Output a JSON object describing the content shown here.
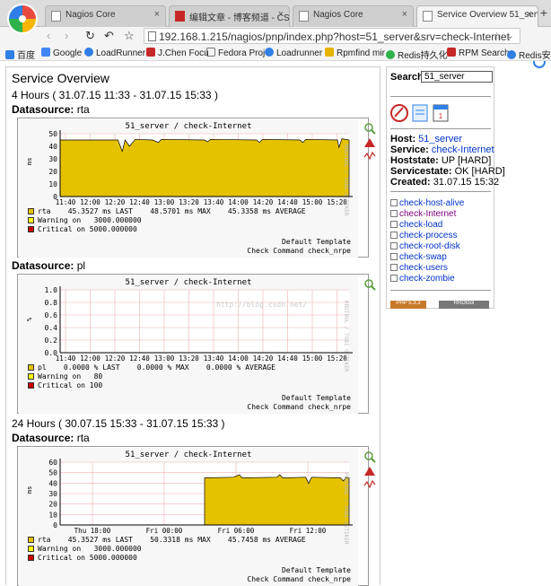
{
  "browser": {
    "tabs": [
      {
        "title": "Nagios Core"
      },
      {
        "title": "编辑文章 - 博客频道 - CSDN"
      },
      {
        "title": "Nagios Core"
      },
      {
        "title": "Service Overview 51_server"
      }
    ],
    "url": "192.168.1.215/nagios/pnp/index.php?host=51_server&srv=check-Internet",
    "bookmarks": [
      "百度",
      "Google",
      "LoadRunner",
      "J.Chen Focu",
      "Fedora Proj",
      "Loadrunner",
      "Rpmfind mir",
      "Redis持久化",
      "RPM Search",
      "Redis安装"
    ]
  },
  "page": {
    "title": "Service Overview",
    "period_4h": "4 Hours ( 31.07.15 11:33 - 31.07.15 15:33 )",
    "period_24h": "24 Hours ( 30.07.15 15:33 - 31.07.15 15:33 )",
    "ds_label": "Datasource:",
    "ds_rta": "rta",
    "ds_pl": "pl"
  },
  "graphs": [
    {
      "title": "51_server / check-Internet",
      "ylabel": "ms",
      "yticks": [
        "50",
        "40",
        "30",
        "20",
        "10",
        "0"
      ],
      "xticks": [
        "11:40",
        "12:00",
        "12:20",
        "12:40",
        "13:00",
        "13:20",
        "13:40",
        "14:00",
        "14:20",
        "14:40",
        "15:00",
        "15:20"
      ],
      "legend": [
        {
          "text": "rta    45.3527 ms LAST    48.5701 ms MAX    45.3358 ms AVERAGE",
          "color": "#e5c200"
        },
        {
          "text": "Warning on   3000.000000",
          "color": "#ffff00"
        },
        {
          "text": "Critical on 5000.000000",
          "color": "#cc0000"
        }
      ],
      "footer": [
        "Default Template",
        "Check Command check_nrpe"
      ]
    },
    {
      "title": "51_server / check-Internet",
      "ylabel": "%",
      "yticks": [
        "1.0",
        "0.8",
        "0.6",
        "0.4",
        "0.2",
        "0.0"
      ],
      "xticks": [
        "11:40",
        "12:00",
        "12:20",
        "12:40",
        "13:00",
        "13:20",
        "13:40",
        "14:00",
        "14:20",
        "14:40",
        "15:00",
        "15:20"
      ],
      "legend": [
        {
          "text": "pl    0.0000 % LAST    0.0000 % MAX    0.0000 % AVERAGE",
          "color": "#e5c200"
        },
        {
          "text": "Warning on   80",
          "color": "#ffff00"
        },
        {
          "text": "Critical on 100",
          "color": "#cc0000"
        }
      ],
      "footer": [
        "Default Template",
        "Check Command check_nrpe"
      ],
      "watermark": "http://blog.csdn.net/"
    },
    {
      "title": "51_server / check-Internet",
      "ylabel": "ms",
      "yticks": [
        "60",
        "50",
        "40",
        "30",
        "20",
        "10",
        "0"
      ],
      "xticks": [
        "Thu 18:00",
        "Fri 00:00",
        "Fri 06:00",
        "Fri 12:00"
      ],
      "legend": [
        {
          "text": "rta    45.3527 ms LAST    50.3318 ms MAX    45.7458 ms AVERAGE",
          "color": "#e5c200"
        },
        {
          "text": "Warning on   3000.000000",
          "color": "#ffff00"
        },
        {
          "text": "Critical on 5000.000000",
          "color": "#cc0000"
        }
      ],
      "footer": [
        "Default Template",
        "Check Command check_nrpe"
      ]
    }
  ],
  "rrdtool_credit": "RRDTOOL / TOBI OETIKER",
  "sidebar": {
    "search_label": "Search:",
    "search_value": "51_server",
    "host_label": "Host:",
    "host_value": "51_server",
    "service_label": "Service:",
    "service_value": "check-Internet",
    "hoststate_label": "Hoststate:",
    "hoststate_value": "UP [HARD]",
    "servicestate_label": "Servicestate:",
    "servicestate_value": "OK [HARD]",
    "created_label": "Created:",
    "created_value": "31.07.15 15:32",
    "services": [
      "check-host-alive",
      "check-Internet",
      "check-load",
      "check-process",
      "check-root-disk",
      "check-swap",
      "check-users",
      "check-zombie"
    ],
    "badges": [
      "PHP 5.3.3",
      "RRDtool"
    ]
  },
  "colors": {
    "area": "#e5c200",
    "grid": "#f0b0b0",
    "link": "#0033cc"
  }
}
